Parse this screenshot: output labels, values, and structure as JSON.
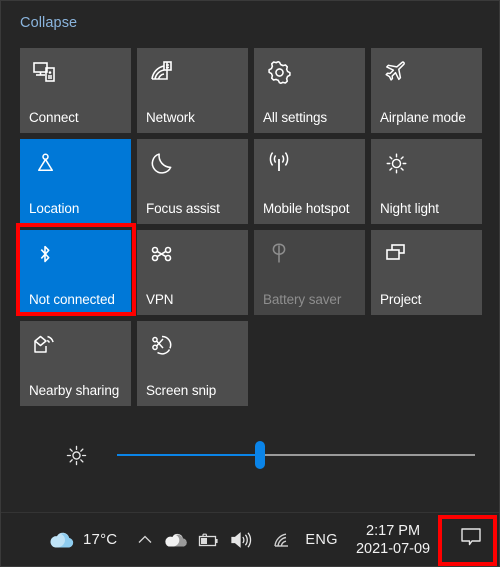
{
  "panel": {
    "collapse_label": "Collapse",
    "accent_color": "#0078d7",
    "tile_color": "#4d4d4d",
    "highlight_color": "#ff0000",
    "background_color": "#262626"
  },
  "tiles": [
    {
      "label": "Connect",
      "icon": "connect-icon",
      "state": "off"
    },
    {
      "label": "Network",
      "icon": "network-icon",
      "state": "off"
    },
    {
      "label": "All settings",
      "icon": "gear-icon",
      "state": "off"
    },
    {
      "label": "Airplane mode",
      "icon": "airplane-icon",
      "state": "off"
    },
    {
      "label": "Location",
      "icon": "location-icon",
      "state": "on"
    },
    {
      "label": "Focus assist",
      "icon": "moon-icon",
      "state": "off"
    },
    {
      "label": "Mobile hotspot",
      "icon": "hotspot-icon",
      "state": "off"
    },
    {
      "label": "Night light",
      "icon": "sun-icon",
      "state": "off"
    },
    {
      "label": "Not connected",
      "icon": "bluetooth-icon",
      "state": "on"
    },
    {
      "label": "VPN",
      "icon": "vpn-icon",
      "state": "off"
    },
    {
      "label": "Battery saver",
      "icon": "battery-leaf-icon",
      "state": "disabled"
    },
    {
      "label": "Project",
      "icon": "project-icon",
      "state": "off"
    },
    {
      "label": "Nearby sharing",
      "icon": "nearby-sharing-icon",
      "state": "off"
    },
    {
      "label": "Screen snip",
      "icon": "screen-snip-icon",
      "state": "off"
    }
  ],
  "brightness": {
    "icon": "brightness-icon",
    "value": 40,
    "fill_color": "#0a84e8",
    "track_color": "#9a9a9a"
  },
  "taskbar": {
    "weather_icon": "weather-cloud-icon",
    "weather_temp": "17°C",
    "chevron_icon": "chevron-up-icon",
    "onedrive_icon": "onedrive-cloud-icon",
    "battery_icon": "battery-charging-icon",
    "volume_icon": "volume-icon",
    "wifi_icon": "wifi-icon",
    "language": "ENG",
    "clock_time": "2:17 PM",
    "clock_date": "2021-07-09",
    "action_center_icon": "action-center-icon"
  },
  "annotations": [
    {
      "name": "bluetooth-tile-highlight",
      "color": "#ff0000"
    },
    {
      "name": "action-center-button-highlight",
      "color": "#ff0000"
    }
  ]
}
